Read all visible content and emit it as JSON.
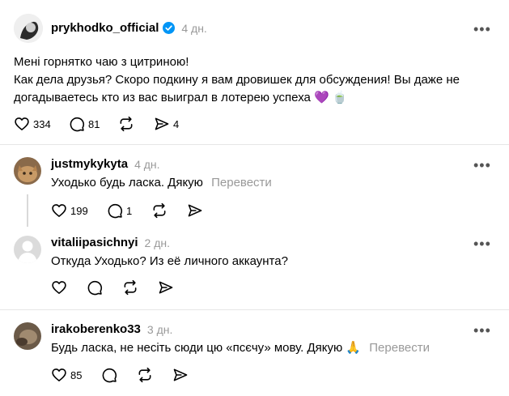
{
  "post": {
    "username": "prykhodko_official",
    "verified": true,
    "time": "4 дн.",
    "more_label": "•••",
    "lines": [
      "Мені горнятко чаю з цитриною!",
      "Как дела друзья? Скоро подкину я вам дровишек для обсуждения! Вы даже не",
      "догадываетесь кто из вас выиграл в лотерею успеха 💜 🍵"
    ],
    "likes": "334",
    "replies": "81",
    "shares": "4"
  },
  "replies": [
    {
      "username": "justmykykyta",
      "time": "4 дн.",
      "text": "Уходько будь ласка. Дякую",
      "translate": "Перевести",
      "likes": "199",
      "replies": "1",
      "more_label": "•••"
    },
    {
      "username": "vitaliipasichnyi",
      "time": "2 дн.",
      "text": "Откуда Уходько? Из её личного аккаунта?",
      "more_label": "•••"
    },
    {
      "username": "irakoberenko33",
      "time": "3 дн.",
      "text": "Будь ласка, не несіть сюди цю «псєчу» мову. Дякую 🙏",
      "translate": "Перевести",
      "likes": "85",
      "more_label": "•••"
    }
  ],
  "colors": {
    "verified": "#0095f6",
    "muted": "#999999",
    "divider": "#e6e6e6"
  },
  "icons": [
    "heart-icon",
    "comment-icon",
    "repost-icon",
    "share-icon",
    "more-icon",
    "verified-icon"
  ]
}
